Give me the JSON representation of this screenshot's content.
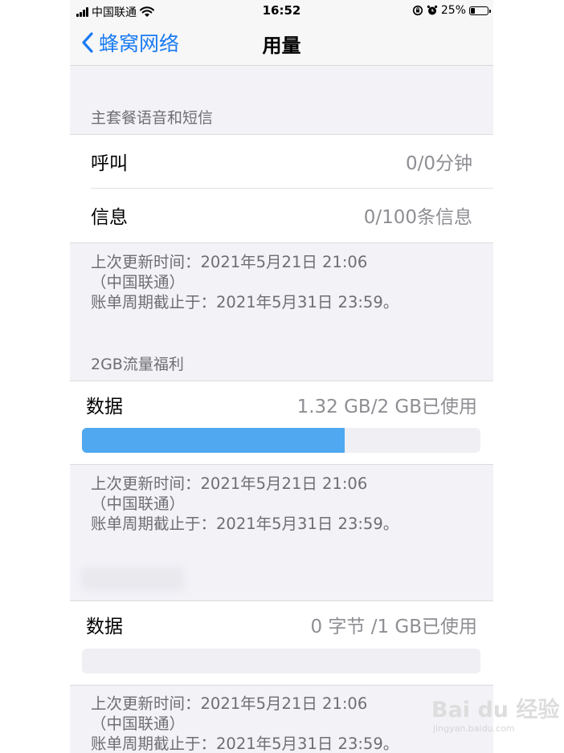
{
  "status_bar": {
    "carrier": "中国联通",
    "time": "16:52",
    "battery_percent": "25%",
    "battery_level": 0.25,
    "icons": [
      "signal-icon",
      "wifi-icon",
      "orientation-lock-icon",
      "alarm-icon",
      "battery-icon"
    ]
  },
  "nav": {
    "back_label": "蜂窝网络",
    "title": "用量"
  },
  "sections": [
    {
      "header": "主套餐语音和短信",
      "rows": [
        {
          "label": "呼叫",
          "value": "0/0分钟"
        },
        {
          "label": "信息",
          "value": "0/100条信息"
        }
      ],
      "footer": [
        "上次更新时间：2021年5月21日 21:06",
        "（中国联通）",
        "账单周期截止于：2021年5月31日 23:59。"
      ]
    },
    {
      "header": "2GB流量福利",
      "row": {
        "label": "数据",
        "value": "1.32 GB/2 GB已使用"
      },
      "usage_fraction": 0.66,
      "footer": [
        "上次更新时间：2021年5月21日 21:06",
        "（中国联通）",
        "账单周期截止于：2021年5月31日 23:59。"
      ]
    },
    {
      "header": "",
      "row": {
        "label": "数据",
        "value": "0 字节 /1 GB已使用"
      },
      "usage_fraction": 0,
      "footer": [
        "上次更新时间：2021年5月21日 21:06",
        "（中国联通）",
        "账单周期截止于：2021年5月31日 23:59。"
      ]
    }
  ],
  "colors": {
    "accent": "#1a7bf2",
    "usage_bar": "#4fa8f0",
    "background": "#f2f2f7"
  },
  "watermark": {
    "text": "Bai du 经验",
    "sub": "jingyan.baidu.com"
  }
}
